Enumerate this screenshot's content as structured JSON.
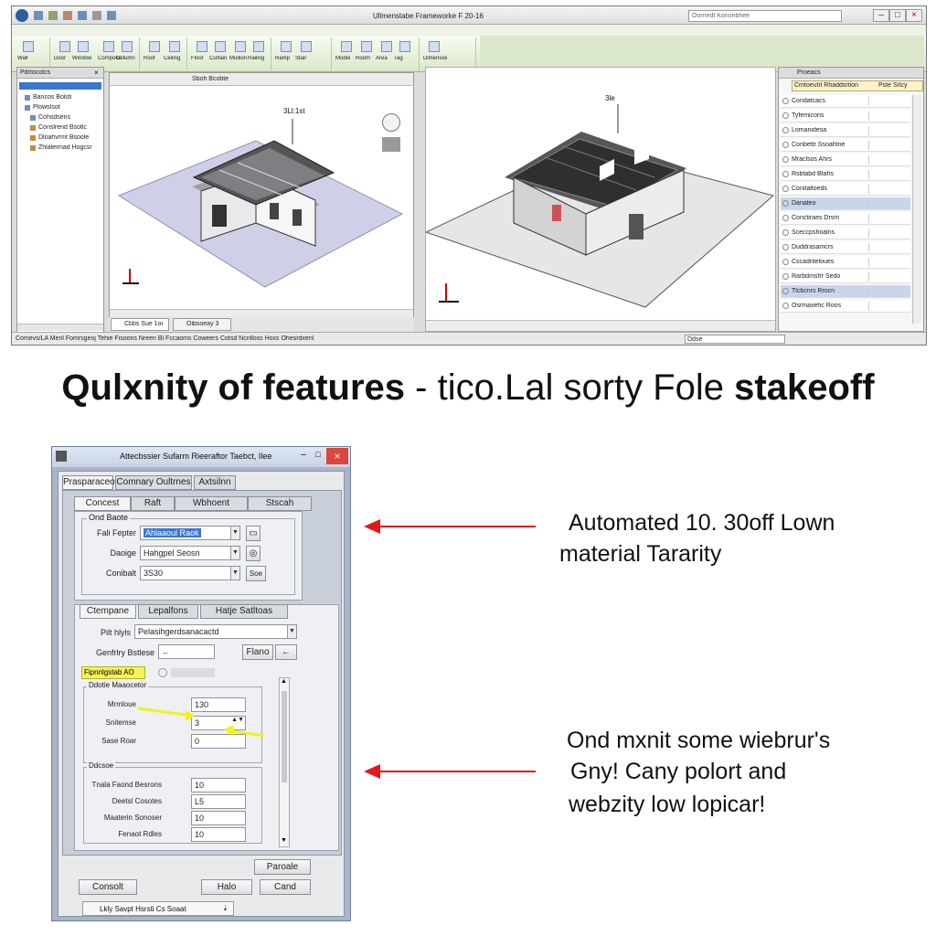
{
  "app": {
    "title": "Ullmenstabe Frameworke F 20-16",
    "search_placeholder": "Oornedt Konoribhee",
    "ribbon_labels": [
      "Wall",
      "Door",
      "Window",
      "Component",
      "Column",
      "Roof",
      "Ceiling",
      "Floor",
      "Curtain",
      "Mullion",
      "Railing",
      "Ramp",
      "Stair",
      "Model",
      "Room",
      "Area",
      "Tag",
      "Dimension"
    ],
    "browser_header": "Pdrtocotcs",
    "browser_items": [
      "Bancos Bolsti",
      "Plowslsot",
      "Cohsdsens",
      "Conslrend Bsotlc",
      "Dloahvrmt Bsoole",
      "Zhlaleirnad Hogcsr"
    ],
    "view1_toolbar": "Sboh Bcobte",
    "view1_label": "3Ll:1st",
    "view2_label": "3le",
    "view_tabs": [
      "Cbbs Sue 1oi",
      "Oibsoeay 3"
    ],
    "props_header": "Proeacs",
    "props_type": "Cmtoeutrl Rhaddsrtion",
    "props_type_btn": "Pste Srlcy",
    "props_rows": [
      "Condatcacs",
      "Tyfemicons",
      "Lomanidesa",
      "Conbettr Ssoahtne",
      "Mraclsos Ahrs",
      "Rsbtabd Btahs",
      "Conitaltoeds",
      "Danateo",
      "Conctiraes Drsm",
      "Sceccpshoalns",
      "Duddrasamcrs",
      "Cscadnteloues",
      "Rarbdmsfrr Sedo",
      "Tlcbcnrs Rrocn",
      "Osrmaxehc Roos"
    ],
    "status_text": "Comevs/LA Menl Fomrsgeoj Tehie Fisoons Nreen Bl Fccaoms Coweers Cotsd Ncnlloss Hoxs Ohesrdxenl",
    "status_right": "Ddse"
  },
  "headline": {
    "part1": "Qulxnity of features",
    "sep": " - ",
    "part2": "tico.Lal sorty Fole ",
    "part3": "stakeoff"
  },
  "dialog": {
    "title": "Attecbssier Sufarm Rieeraftor Taebct, Ilee",
    "tabs": [
      "Prasparaceo",
      "Comnary Oultrnes",
      "Axtsilnn"
    ],
    "subtabs": [
      "Concest",
      "Raft",
      "Wbhoent",
      "Stscah"
    ],
    "group1_title": "Ond Baote",
    "rows1": [
      {
        "label": "Fali Fepter",
        "value": "Ahlaaoul Raok"
      },
      {
        "label": "Daoige",
        "value": "Hahgpel Seosn"
      },
      {
        "label": "Conibalt",
        "value": "3S30"
      }
    ],
    "rows1_btn": "Soe",
    "tabs2": [
      "Ctempane",
      "Lepalfons",
      "Hatje Satltoas"
    ],
    "row_proj_label": "Pilt hlyls",
    "row_proj_value": "Pelasihgerdsanacactd",
    "row_gen_label": "Genfrlry Bstlese",
    "row_gen_btn": "Flano",
    "highlight": "Fipnnlgstab AO",
    "group2_title": "Ddotie Maaocetor",
    "rows2": [
      {
        "label": "Mrmloue",
        "value": "130"
      },
      {
        "label": "Snitemse",
        "value": "3"
      },
      {
        "label": "Sase Roar",
        "value": "0"
      }
    ],
    "group3_title": "Ddcsoe",
    "rows3": [
      {
        "label": "Tnala Faond Besrons",
        "value": "10"
      },
      {
        "label": "Deetsl Cosotes",
        "value": "L5"
      },
      {
        "label": "Maaterin Sonoser",
        "value": "10"
      },
      {
        "label": "Fenaot Rdles",
        "value": "10"
      }
    ],
    "btn_apply": "Paroale",
    "btn_consult": "Consolt",
    "btn_help": "Halo",
    "btn_cancel": "Cand",
    "footer_select": "Lkly Savpt Hsrsti Cs Soaat"
  },
  "annotations": {
    "a1_line1": "Automated 10. 30off Lown",
    "a1_line2": "material Tararity",
    "a2_line1": "Ond mxnit some wiebrur's",
    "a2_line2": "Gny! Cany polort and",
    "a2_line3": "webzity low lopicar!"
  },
  "colors": {
    "arrow": "#e01b1b",
    "highlight_arrow": "#f2f21a",
    "ribbon_green": "#dbe8cc",
    "dialog_frame": "#a9b4c6",
    "selection_blue": "#3b76d1"
  }
}
